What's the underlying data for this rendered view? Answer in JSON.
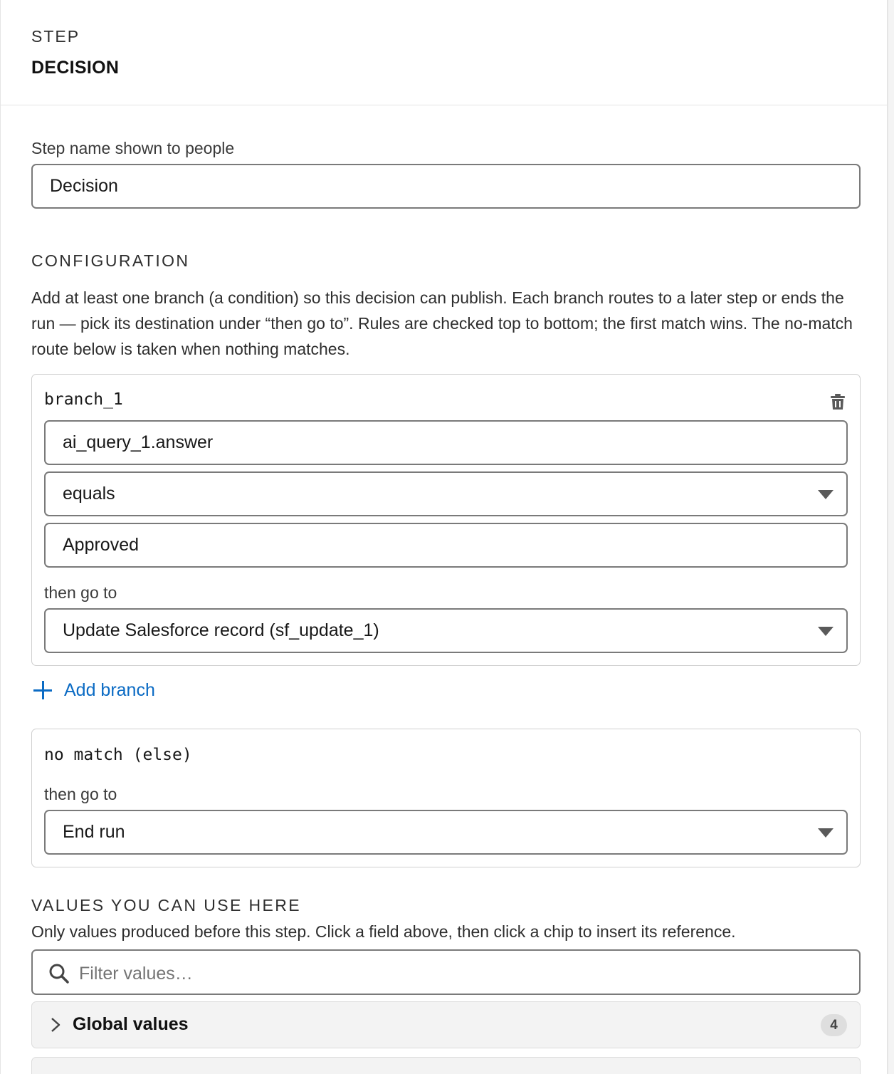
{
  "header": {
    "eyebrow": "STEP",
    "title": "DECISION"
  },
  "step_name": {
    "label": "Step name shown to people",
    "value": "Decision"
  },
  "configuration": {
    "heading": "CONFIGURATION",
    "description": "Add at least one branch (a condition) so this decision can publish. Each branch routes to a later step or ends the run — pick its destination under “then go to”. Rules are checked top to bottom; the first match wins. The no-match route below is taken when nothing matches."
  },
  "branches": [
    {
      "name": "branch_1",
      "field": "ai_query_1.answer",
      "operator": "equals",
      "value": "Approved",
      "then_label": "then go to",
      "destination": "Update Salesforce record (sf_update_1)",
      "delete_icon": "trash-icon"
    }
  ],
  "add_branch": {
    "label": "Add branch",
    "icon": "plus-icon",
    "color": "#0b6bc4"
  },
  "else_branch": {
    "name": "no match (else)",
    "then_label": "then go to",
    "destination": "End run"
  },
  "values": {
    "heading": "VALUES YOU CAN USE HERE",
    "hint": "Only values produced before this step. Click a field above, then click a chip to insert its reference.",
    "filter_placeholder": "Filter values…",
    "groups": [
      {
        "title": "Global values",
        "count": "4",
        "icon": "chevron-right-icon"
      }
    ]
  }
}
